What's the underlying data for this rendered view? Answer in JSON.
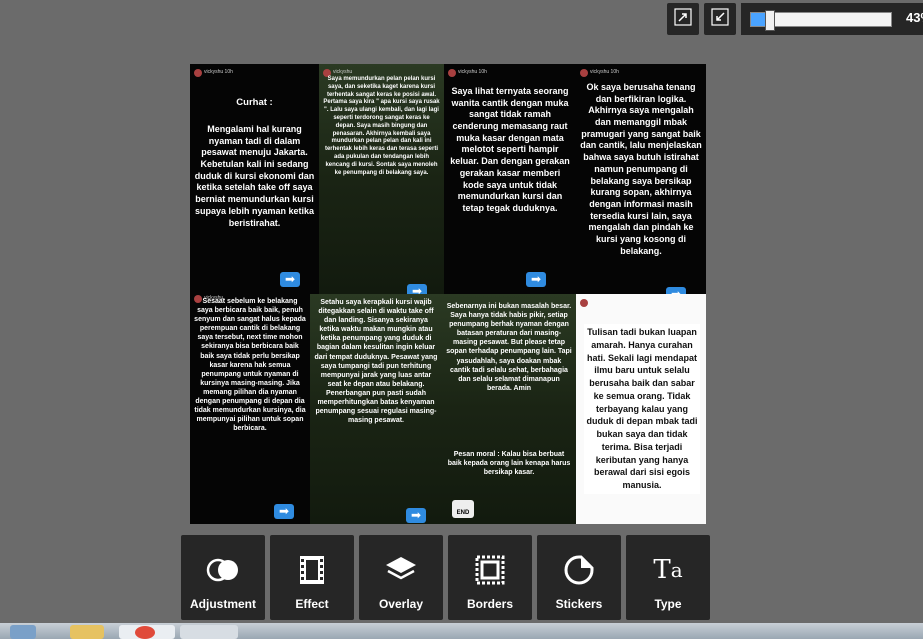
{
  "zoom": {
    "value_text": "43%",
    "level": 0.1
  },
  "top_buttons": [
    {
      "icon": "expand-icon"
    },
    {
      "icon": "shrink-icon"
    }
  ],
  "panels": {
    "p1": {
      "username": "vickyshu 10h",
      "title": "Curhat :",
      "body": "Mengalami hal kurang nyaman tadi di dalam pesawat menuju Jakarta. Kebetulan kali ini sedang duduk di kursi ekonomi dan ketika setelah take off saya berniat memundurkan kursi supaya lebih nyaman ketika beristirahat."
    },
    "p2": {
      "username": "vickyshu",
      "body": "Saya memundurkan pelan pelan kursi saya, dan seketika kaget karena kursi terhentak sangat keras ke posisi awal. Pertama saya kira \" apa kursi saya rusak \". Lalu saya ulangi kembali, dan lagi lagi seperti terdorong sangat keras ke depan. Saya masih bingung dan penasaran. Akhirnya kembali saya mundurkan pelan pelan dan kali ini terhentak lebih keras dan terasa seperti ada pukulan dan tendangan lebih kencang di kursi. Sontak saya menoleh ke penumpang di belakang saya."
    },
    "p3": {
      "username": "vickyshu 10h",
      "body": "Saya lihat ternyata seorang wanita cantik dengan muka sangat tidak ramah cenderung memasang raut muka kasar dengan mata melotot seperti hampir keluar. Dan dengan gerakan gerakan kasar memberi kode saya untuk tidak memundurkan kursi dan tetap tegak duduknya."
    },
    "p4": {
      "username": "vickyshu 10h",
      "body": "Ok saya berusaha tenang dan berfikiran logika. Akhirnya saya mengalah dan memanggil mbak pramugari yang sangat baik dan cantik, lalu menjelaskan bahwa saya butuh istirahat namun penumpang di belakang saya bersikap kurang sopan, akhirnya dengan informasi masih tersedia kursi lain, saya mengalah dan pindah ke kursi yang kosong di belakang."
    },
    "p5": {
      "username": "vickyshu",
      "body": "Sesaat sebelum ke belakang saya berbicara baik baik, penuh senyum dan sangat halus kepada perempuan cantik di belakang saya tersebut, next time mohon sekiranya bisa berbicara baik baik saya tidak perlu bersikap kasar karena hak semua penumpang untuk nyaman di kursinya masing-masing. Jika memang pilihan dia nyaman dengan penumpang di depan dia tidak memundurkan kursinya, dia mempunyai pilihan untuk sopan berbicara."
    },
    "p6": {
      "body": "Setahu saya kerapkali kursi wajib ditegakkan selain di waktu take off dan landing. Sisanya sekiranya ketika waktu makan mungkin atau ketika penumpang yang duduk di bagian dalam kesulitan ingin keluar dari tempat duduknya. Pesawat yang saya tumpangi tadi pun terhitung mempunyai jarak yang luas antar seat ke depan atau belakang. Penerbangan pun pasti sudah memperhitungkan batas kenyaman penumpang sesuai regulasi masing-masing pesawat."
    },
    "p7": {
      "body": "Sebenarnya ini bukan masalah besar. Saya hanya tidak habis pikir, setiap penumpang berhak nyaman dengan batasan peraturan dari masing-masing pesawat. But please tetap sopan terhadap penumpang lain. Tapi yasudahlah, saya doakan mbak cantik tadi selalu sehat, berbahagia dan selalu selamat dimanapun berada. Amin",
      "moral": "Pesan moral : Kalau bisa berbuat baik kepada orang lain kenapa harus bersikap kasar.",
      "end_label": "END"
    },
    "p8": {
      "body": "Tulisan tadi bukan luapan amarah. Hanya curahan hati. Sekali lagi mendapat ilmu baru untuk selalu berusaha baik dan sabar ke semua orang. Tidak terbayang kalau yang duduk di depan mbak tadi bukan saya dan tidak terima. Bisa terjadi keributan yang hanya berawal dari sisi egois manusia."
    }
  },
  "tools": [
    {
      "label": "Adjustment",
      "icon": "adjustment-icon"
    },
    {
      "label": "Effect",
      "icon": "film-strip-icon"
    },
    {
      "label": "Overlay",
      "icon": "layers-icon"
    },
    {
      "label": "Borders",
      "icon": "border-frame-icon"
    },
    {
      "label": "Stickers",
      "icon": "sticker-icon"
    },
    {
      "label": "Type",
      "icon": "type-icon"
    }
  ]
}
